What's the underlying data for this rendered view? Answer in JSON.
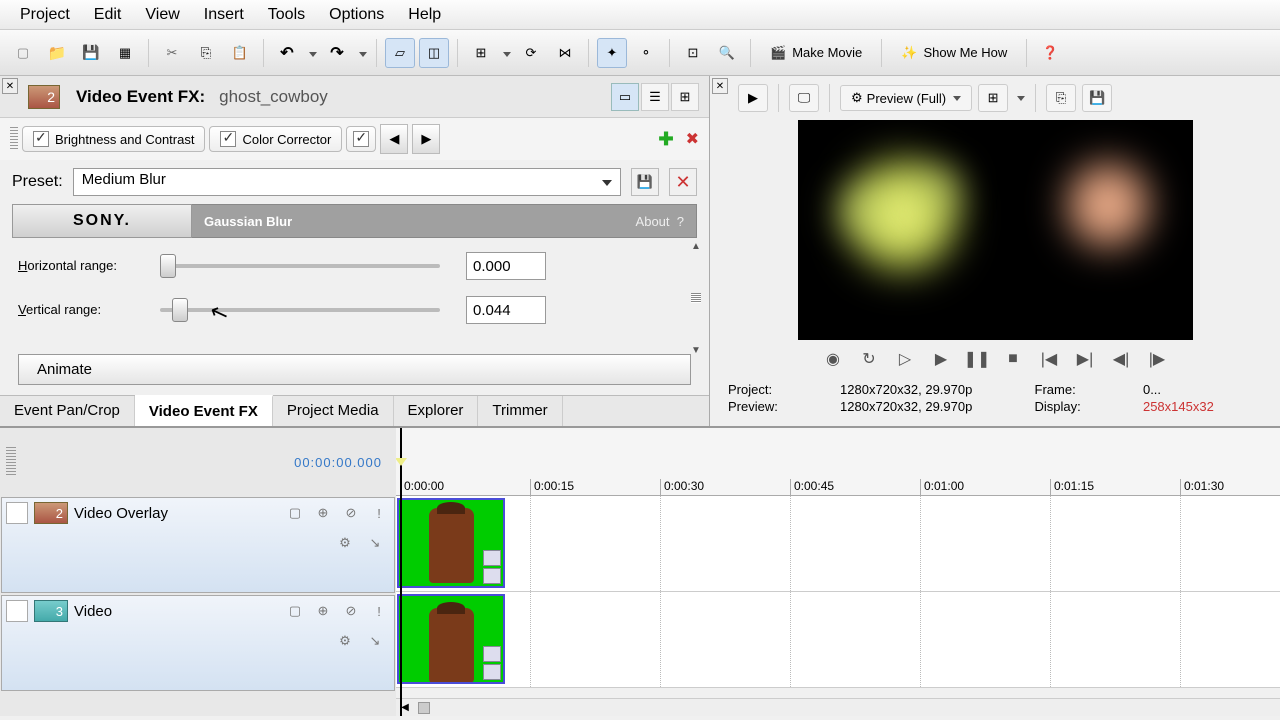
{
  "menu": [
    "Project",
    "Edit",
    "View",
    "Insert",
    "Tools",
    "Options",
    "Help"
  ],
  "toolbar": {
    "make_movie": "Make Movie",
    "show_me_how": "Show Me How"
  },
  "fx": {
    "title": "Video Event FX:",
    "name": "ghost_cowboy",
    "track_num": "2",
    "chain": [
      "Brightness and Contrast",
      "Color Corrector"
    ],
    "preset_label": "Preset:",
    "preset_value": "Medium Blur",
    "brand": "SONY.",
    "effect_name": "Gaussian Blur",
    "about": "About",
    "horizontal_label_u": "H",
    "horizontal_label_rest": "orizontal range:",
    "horizontal_value": "0.000",
    "vertical_label_u": "V",
    "vertical_label_rest": "ertical range:",
    "vertical_value": "0.044",
    "animate": "Animate"
  },
  "tabs": [
    "Event Pan/Crop",
    "Video Event FX",
    "Project Media",
    "Explorer",
    "Trimmer"
  ],
  "preview": {
    "quality": "Preview (Full)",
    "project_label": "Project:",
    "project_val": "1280x720x32, 29.970p",
    "preview_label": "Preview:",
    "preview_val": "1280x720x32, 29.970p",
    "frame_label": "Frame:",
    "frame_val": "0...",
    "display_label": "Display:",
    "display_val": "258x145x32"
  },
  "timecode": "00:00:00.000",
  "ruler": [
    "0:00:00",
    "0:00:15",
    "0:00:30",
    "0:00:45",
    "0:01:00",
    "0:01:15",
    "0:01:30"
  ],
  "tracks": [
    {
      "num": "2",
      "name": "Video Overlay",
      "color": "c1"
    },
    {
      "num": "3",
      "name": "Video",
      "color": "c2"
    }
  ]
}
